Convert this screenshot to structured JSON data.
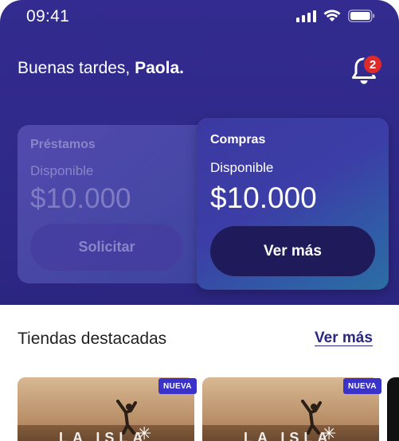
{
  "status_bar": {
    "time": "09:41"
  },
  "header": {
    "greeting_prefix": "Buenas tardes, ",
    "user_name": "Paola.",
    "notification_count": "2"
  },
  "cards": [
    {
      "title": "Préstamos",
      "label": "Disponible",
      "amount": "$10.000",
      "button": "Solicitar",
      "state": "inactive"
    },
    {
      "title": "Compras",
      "label": "Disponible",
      "amount": "$10.000",
      "button": "Ver más",
      "state": "active"
    }
  ],
  "stores_section": {
    "title": "Tiendas destacadas",
    "link": "Ver más",
    "stores": [
      {
        "badge": "NUEVA",
        "logo": "LA ISLA"
      },
      {
        "badge": "NUEVA",
        "logo": "LA ISLA"
      }
    ]
  },
  "colors": {
    "header_bg": "#332b8f",
    "primary_button": "#1f1b5a",
    "badge_red": "#e02a2a",
    "badge_nueva": "#3b33c8",
    "link": "#2b2680"
  }
}
